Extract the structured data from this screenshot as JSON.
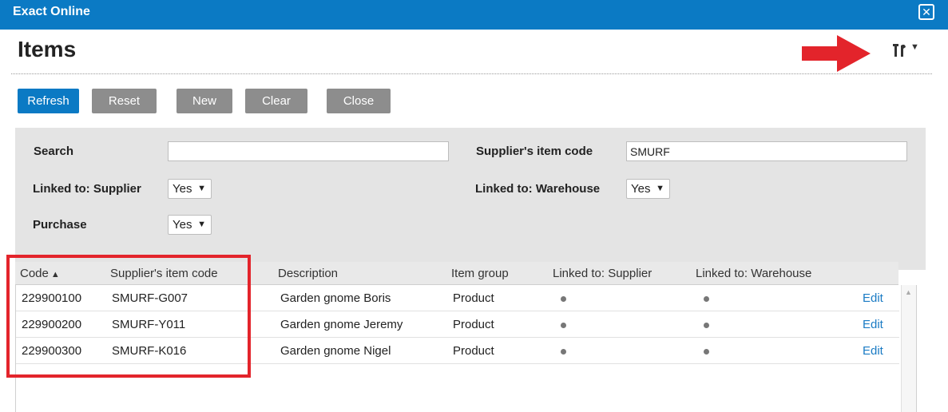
{
  "window": {
    "app_title": "Exact Online",
    "close_icon": "close-icon"
  },
  "page": {
    "title": "Items"
  },
  "toolbar": {
    "buttons": [
      {
        "label": "Refresh"
      },
      {
        "label": "Reset"
      },
      {
        "label": "New"
      },
      {
        "label": "Clear"
      },
      {
        "label": "Close"
      }
    ],
    "tools_icon": "tools-icon",
    "tools_caret": "▼"
  },
  "filters": {
    "search": {
      "label": "Search",
      "value": ""
    },
    "supplier_item_code": {
      "label": "Supplier's item code",
      "value": "SMURF"
    },
    "linked_supplier": {
      "label": "Linked to: Supplier",
      "value": "Yes"
    },
    "linked_warehouse": {
      "label": "Linked to: Warehouse",
      "value": "Yes"
    },
    "purchase": {
      "label": "Purchase",
      "value": "Yes"
    },
    "select_arrow": "▼"
  },
  "grid": {
    "columns": {
      "code": "Code",
      "supplier_item_code": "Supplier's item code",
      "description": "Description",
      "item_group": "Item group",
      "linked_supplier": "Linked to: Supplier",
      "linked_warehouse": "Linked to: Warehouse"
    },
    "sort_indicator": "▲",
    "edit_label": "Edit",
    "rows": [
      {
        "code": "229900100",
        "supplier_item_code": "SMURF-G007",
        "description": "Garden gnome Boris",
        "item_group": "Product",
        "linked_supplier": true,
        "linked_warehouse": true
      },
      {
        "code": "229900200",
        "supplier_item_code": "SMURF-Y011",
        "description": "Garden gnome Jeremy",
        "item_group": "Product",
        "linked_supplier": true,
        "linked_warehouse": true
      },
      {
        "code": "229900300",
        "supplier_item_code": "SMURF-K016",
        "description": "Garden gnome Nigel",
        "item_group": "Product",
        "linked_supplier": true,
        "linked_warehouse": true
      }
    ]
  },
  "colors": {
    "brand_blue": "#0b7ac4",
    "button_gray": "#8d8d8d",
    "panel_gray": "#e4e4e4",
    "annotation_red": "#e3242b",
    "link_blue": "#1a7bc4"
  }
}
